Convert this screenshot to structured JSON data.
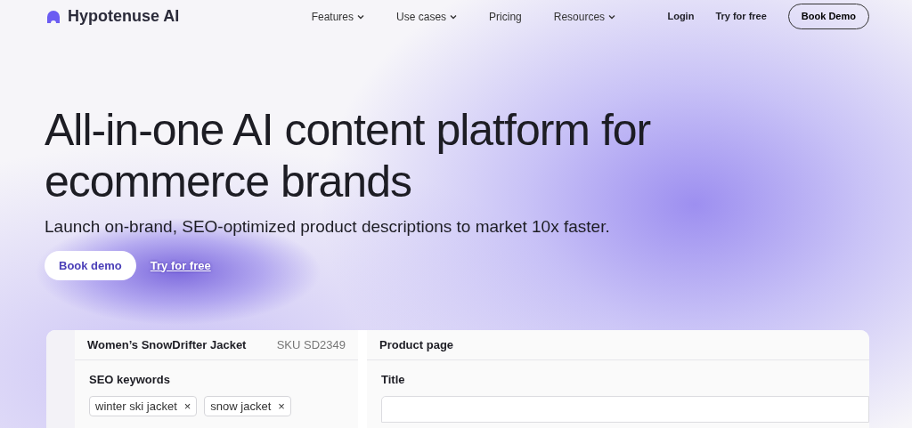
{
  "brand": {
    "name": "Hypotenuse AI"
  },
  "nav": [
    {
      "label": "Features",
      "dropdown": true
    },
    {
      "label": "Use cases",
      "dropdown": true
    },
    {
      "label": "Pricing",
      "dropdown": false
    },
    {
      "label": "Resources",
      "dropdown": true
    }
  ],
  "actions": {
    "login": "Login",
    "try": "Try for free",
    "demo": "Book Demo"
  },
  "hero": {
    "title": "All-in-one AI content platform for ecommerce brands",
    "subtitle": "Launch on-brand, SEO-optimized product descriptions to market 10x faster.",
    "primary": "Book demo",
    "link": "Try for free"
  },
  "mockup": {
    "product": "Women’s SnowDrifter Jacket",
    "sku": "SKU SD2349",
    "keywords_label": "SEO keywords",
    "keywords": [
      {
        "text": "winter ski jacket",
        "remove": "×"
      },
      {
        "text": "snow jacket",
        "remove": "×"
      }
    ],
    "right_title": "Product page",
    "field_label": "Title"
  }
}
